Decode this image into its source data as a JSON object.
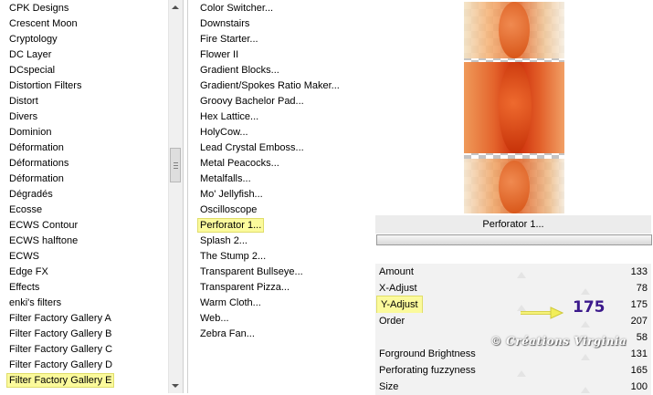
{
  "categories": {
    "items": [
      "CPK Designs",
      "Crescent Moon",
      "Cryptology",
      "DC Layer",
      "DCspecial",
      "Distortion Filters",
      "Distort",
      "Divers",
      "Dominion",
      "Déformation",
      "Déformations",
      "Déformation",
      "Dégradés",
      "Ecosse",
      "ECWS Contour",
      "ECWS halftone",
      "ECWS",
      "Edge FX",
      "Effects",
      "enki's filters",
      "Filter Factory Gallery A",
      "Filter Factory Gallery B",
      "Filter Factory Gallery C",
      "Filter Factory Gallery D",
      "Filter Factory Gallery E"
    ],
    "selected": "Filter Factory Gallery E"
  },
  "filters": {
    "items": [
      "Color Switcher...",
      "Downstairs",
      "Fire Starter...",
      "Flower II",
      "Gradient Blocks...",
      "Gradient/Spokes Ratio Maker...",
      "Groovy Bachelor Pad...",
      "Hex Lattice...",
      "HolyCow...",
      "Lead Crystal Emboss...",
      "Metal Peacocks...",
      "Metalfalls...",
      "Mo' Jellyfish...",
      "Oscilloscope",
      "Perforator 1...",
      "Splash 2...",
      "The Stump 2...",
      "Transparent Bullseye...",
      "Transparent Pizza...",
      "Warm Cloth...",
      "Web...",
      "Zebra Fan..."
    ],
    "selected": "Perforator 1..."
  },
  "preview": {
    "title": "Perforator 1...",
    "progress": 1.0
  },
  "params": [
    {
      "label": "Amount",
      "value": "133"
    },
    {
      "label": "X-Adjust",
      "value": "78"
    },
    {
      "label": "Y-Adjust",
      "value": "175"
    },
    {
      "label": "Order",
      "value": "207"
    },
    {
      "label": "",
      "value": "58"
    },
    {
      "label": "Forground Brightness",
      "value": "131"
    },
    {
      "label": "Perforating fuzzyness",
      "value": "165"
    },
    {
      "label": "Size",
      "value": "100"
    }
  ],
  "selected_param": "Y-Adjust",
  "callout": {
    "value": "175",
    "arrow_color": "#f2ee5a"
  },
  "watermark": "© Créations Virginia",
  "colors": {
    "selection": "#fbfa9c",
    "callout_text": "#3c1a8c",
    "preview_orange": "#e2642a",
    "preview_red": "#d2330c"
  }
}
